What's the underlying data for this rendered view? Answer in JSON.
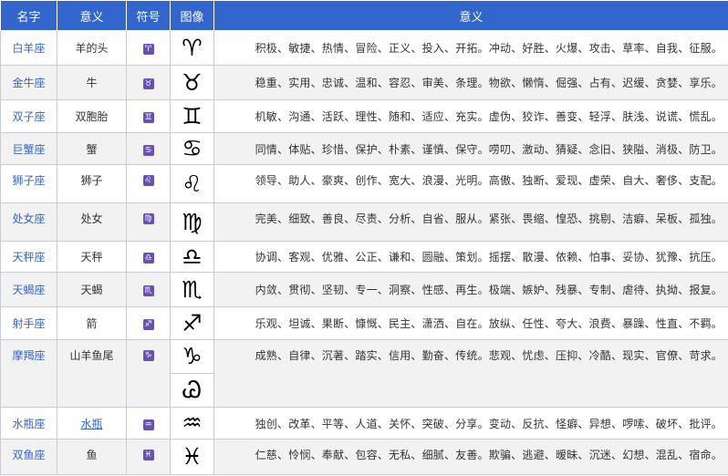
{
  "headers": {
    "name": "名字",
    "meaning": "意义",
    "symbol": "符号",
    "image": "图像",
    "keywords": "意义"
  },
  "rows": [
    {
      "name": "白羊座",
      "meaning": "羊的头",
      "symbol": "♈",
      "glyph": "♈",
      "keywords": "积极、敏捷、热情、冒险、正义、投入、开拓。冲动、好胜、火爆、攻击、草率、自我、征服。"
    },
    {
      "name": "金牛座",
      "meaning": "牛",
      "symbol": "♉",
      "glyph": "♉",
      "keywords": "稳重、实用、忠诚、温和、容忍、审美、条理。物欲、懒惰、倔强、占有、迟缓、贪婪、享乐。"
    },
    {
      "name": "双子座",
      "meaning": "双胞胎",
      "symbol": "♊",
      "glyph": "♊",
      "keywords": "机敏、沟通、活跃、理性、随和、适应、充实。虚伪、狡诈、善变、轻浮、肤浅、说谎、慌乱。"
    },
    {
      "name": "巨蟹座",
      "meaning": "蟹",
      "symbol": "♋",
      "glyph": "♋",
      "keywords": "同情、体贴、珍惜、保护、朴素、谨慎、保守。唠叨、激动、猜疑、念旧、狭隘、消极、防卫。"
    },
    {
      "name": "狮子座",
      "meaning": "狮子",
      "symbol": "♌",
      "glyph": "♌",
      "keywords": "领导、助人、豪爽、创作、宽大、浪漫、光明。高傲、独断、爱现、虚荣、自大、奢侈、支配。"
    },
    {
      "name": "处女座",
      "meaning": "处女",
      "symbol": "♍",
      "glyph": "♍",
      "keywords": "完美、细致、善良、尽责、分析、自省、服从。紧张、畏缩、惶恐、挑剔、洁癖、呆板、孤独。"
    },
    {
      "name": "天秤座",
      "meaning": "天秤",
      "symbol": "♎",
      "glyph": "♎",
      "keywords": "协调、客观、优雅、公正、谦和、圆融、策划。摇摆、散漫、依赖、怕事、妥协、犹豫、抗压。"
    },
    {
      "name": "天蝎座",
      "meaning": "天蝎",
      "symbol": "♏",
      "glyph": "♏",
      "keywords": "内敛、贯彻、坚韧、专一、洞察、性感、再生。极端、嫉妒、残暴、专制、虐待、执拗、报复。"
    },
    {
      "name": "射手座",
      "meaning": "箭",
      "symbol": "♐",
      "glyph": "♐",
      "keywords": "乐观、坦诚、果断、慷慨、民主、潇洒、自在。放纵、任性、夸大、浪费、暴躁、性直、不羁。"
    },
    {
      "name": "摩羯座",
      "meaning": "山羊鱼尾",
      "symbol": "♑",
      "glyph": "♑",
      "glyph_alt": "Ꮚ",
      "keywords": "成熟、自律、沉著、踏实、信用、勤奋、传统。悲观、忧虑、压抑、冷酷、现实、官僚、苛求。"
    },
    {
      "name": "水瓶座",
      "meaning": "水瓶",
      "symbol": "♒",
      "glyph": "♒",
      "keywords": "独创、改革、平等、人道、关怀、突破、分享。变动、反抗、怪癖、异想、啰嗦、破坏、批评。"
    },
    {
      "name": "双鱼座",
      "meaning": "鱼",
      "symbol": "♓",
      "glyph": "♓",
      "keywords": "仁慈、怜悯、奉献、包容、无私、细腻、友善。欺骗、逃避、暧昧、沉迷、幻想、混乱、宿命。"
    }
  ]
}
